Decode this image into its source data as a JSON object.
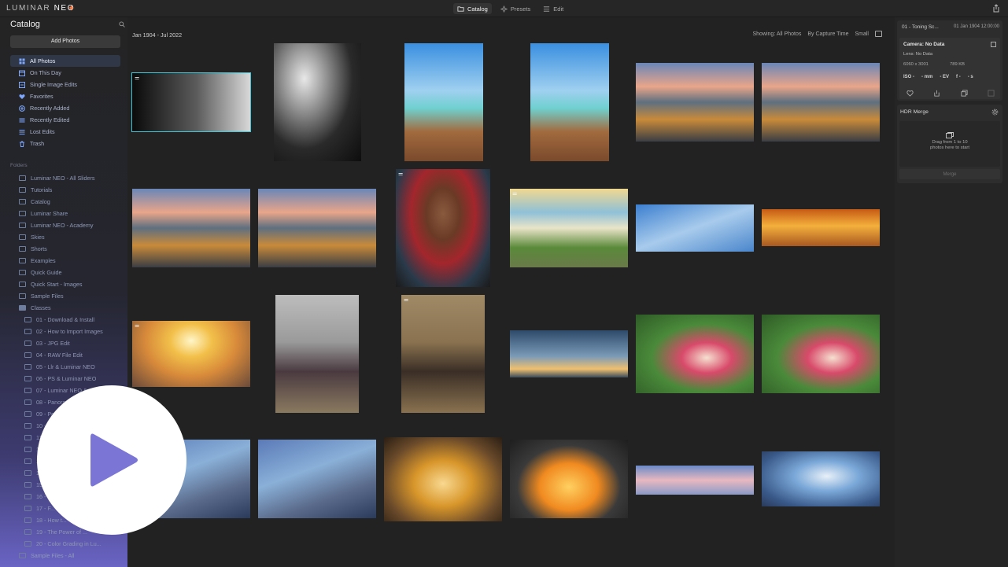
{
  "topbar": {
    "logo_a": "LUMINAR",
    "logo_b": " NEO",
    "tabs": [
      {
        "label": "Catalog",
        "active": true
      },
      {
        "label": "Presets",
        "active": false
      },
      {
        "label": "Edit",
        "active": false
      }
    ]
  },
  "sidebar": {
    "title": "Catalog",
    "add_label": "Add Photos",
    "nav": [
      {
        "label": "All Photos",
        "icon": "grid-icon",
        "active": true
      },
      {
        "label": "On This Day",
        "icon": "calendar-icon"
      },
      {
        "label": "Single Image Edits",
        "icon": "stack-icon"
      },
      {
        "label": "Favorites",
        "icon": "heart-icon"
      },
      {
        "label": "Recently Added",
        "icon": "plus-circle-icon"
      },
      {
        "label": "Recently Edited",
        "icon": "sliders-icon"
      },
      {
        "label": "Lost Edits",
        "icon": "list-icon"
      },
      {
        "label": "Trash",
        "icon": "trash-icon"
      }
    ],
    "section_label": "Folders",
    "folders": [
      {
        "label": "Luminar NEO - All Sliders"
      },
      {
        "label": "Tutorials"
      },
      {
        "label": "Catalog"
      },
      {
        "label": "Luminar Share"
      },
      {
        "label": "Luminar NEO - Academy"
      },
      {
        "label": "Skies"
      },
      {
        "label": "Shorts"
      },
      {
        "label": "Examples"
      },
      {
        "label": "Quick Guide"
      },
      {
        "label": "Quick Start - Images"
      },
      {
        "label": "Sample Files"
      },
      {
        "label": "Classes",
        "open": true
      },
      {
        "label": "01 - Download & Install",
        "child": true
      },
      {
        "label": "02 - How to Import Images",
        "child": true
      },
      {
        "label": "03 - JPG Edit",
        "child": true
      },
      {
        "label": "04 - RAW File Edit",
        "child": true
      },
      {
        "label": "05 - Llr & Luminar NEO",
        "child": true
      },
      {
        "label": "06 - PS & Luminar NEO",
        "child": true
      },
      {
        "label": "07 - Luminar NEO & ...",
        "child": true
      },
      {
        "label": "08 - Panora...",
        "child": true
      },
      {
        "label": "09 - Po...",
        "child": true
      },
      {
        "label": "10 - ...",
        "child": true
      },
      {
        "label": "11 - ...",
        "child": true
      },
      {
        "label": "12 - ...",
        "child": true
      },
      {
        "label": "13 - ...",
        "child": true
      },
      {
        "label": "14 - ...",
        "child": true
      },
      {
        "label": "15 - ...",
        "child": true
      },
      {
        "label": "16 - ...",
        "child": true
      },
      {
        "label": "17 - F...",
        "child": true
      },
      {
        "label": "18 - How t...",
        "child": true
      },
      {
        "label": "19 - The Power of ...",
        "child": true
      },
      {
        "label": "20 - Color Grading in Lu...",
        "child": true
      },
      {
        "label": "Sample Files - All",
        "child": false
      }
    ]
  },
  "main": {
    "date_range": "Jan 1904 - Jul 2022",
    "filters": [
      "Showing: All Photos",
      "By Capture Time",
      "Small"
    ]
  },
  "info": {
    "title": "01 - Toning Sc...",
    "date": "01 Jan 1904 12:00:00",
    "camera": "Camera: No Data",
    "lens": "Lens: No Data",
    "dims": "6060 x 3001",
    "size": "789 KB",
    "exif": [
      "ISO -",
      "- mm",
      "- EV",
      "f -",
      "- s"
    ]
  },
  "hdr": {
    "title": "HDR Merge",
    "line1": "Drag from 1 to 10",
    "line2": "photos here to start",
    "merge_label": "Merge"
  },
  "colors": {
    "selection": "#3fc7d9",
    "accent_gradient": "#6a64c4"
  }
}
